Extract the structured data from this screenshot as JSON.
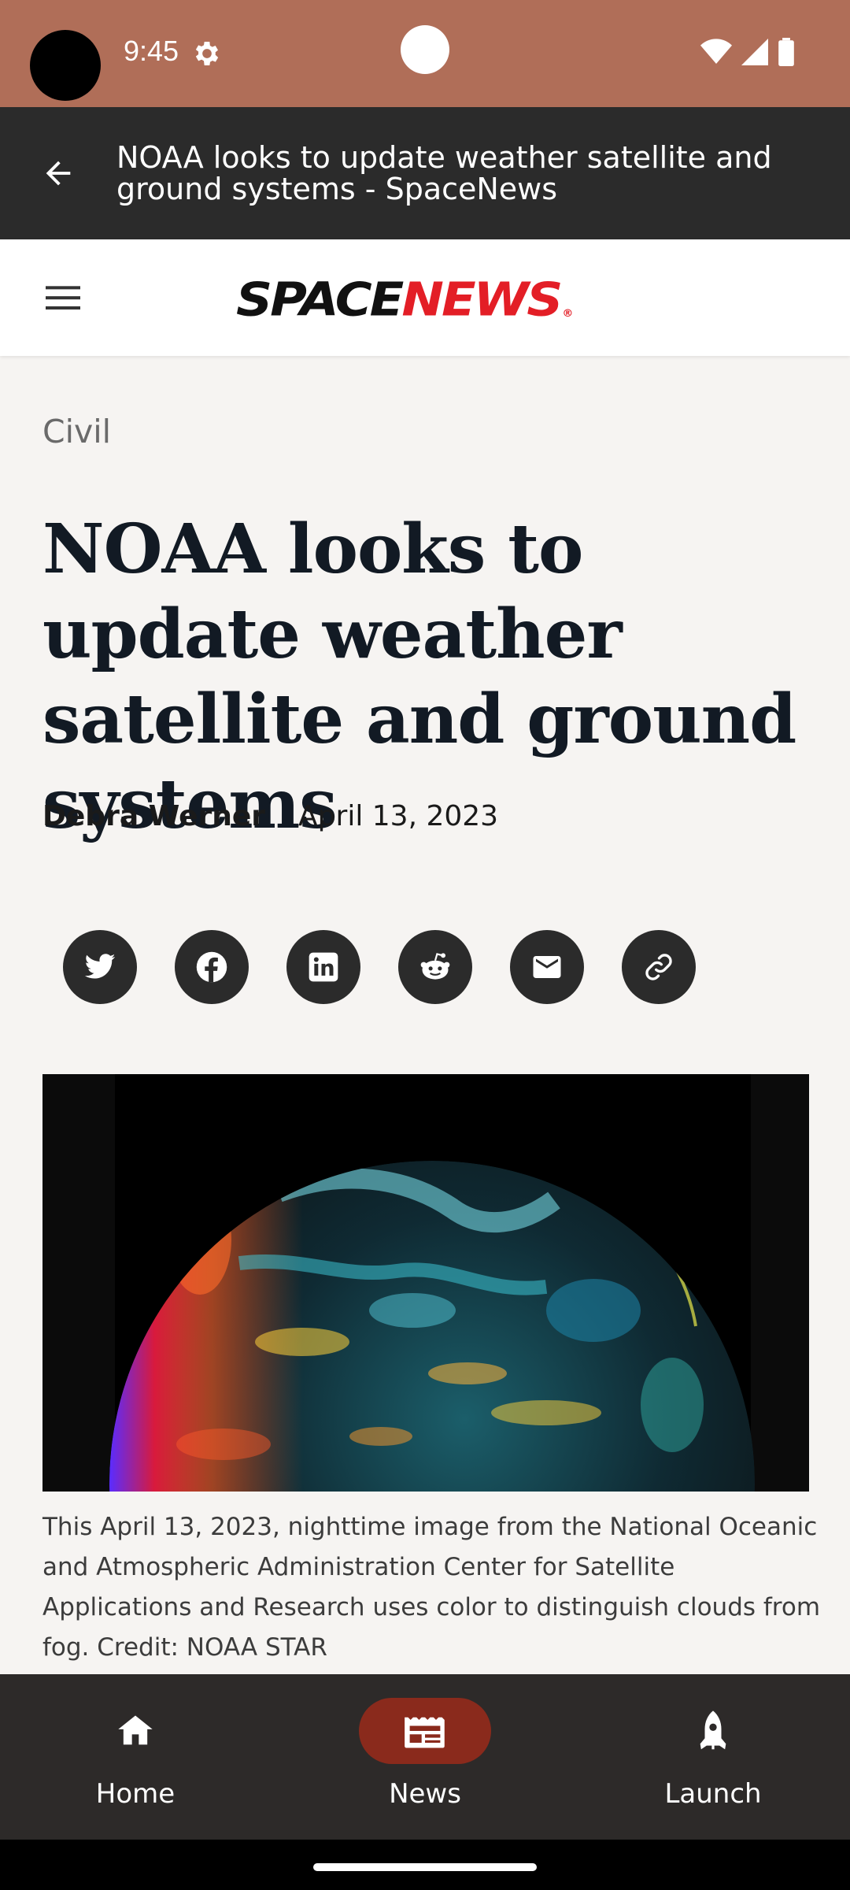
{
  "status_bar": {
    "time": "9:45",
    "color": "#b06e58"
  },
  "app_bar": {
    "title": "NOAA looks to update weather satellite and ground systems - SpaceNews",
    "back_icon": "arrow-left-icon"
  },
  "site_header": {
    "logo_space": "SPACE",
    "logo_news": "NEWS",
    "logo_mark": "®",
    "menu_icon": "hamburger-menu-icon",
    "brand_red": "#e31e26"
  },
  "article": {
    "category": "Civil",
    "headline": "NOAA looks to update weather satellite and ground systems",
    "author": "Debra Werner",
    "date": "April 13, 2023",
    "share_icons": [
      "twitter-icon",
      "facebook-icon",
      "linkedin-icon",
      "reddit-icon",
      "email-icon",
      "link-icon"
    ],
    "caption": "This April 13, 2023, nighttime image from the National Oceanic and Atmospheric Administration Center for Satellite Applications and Research uses color to distinguish clouds from fog. Credit: NOAA STAR"
  },
  "bottom_nav": {
    "items": [
      {
        "label": "Home",
        "icon": "home-icon",
        "active": false
      },
      {
        "label": "News",
        "icon": "news-icon",
        "active": true
      },
      {
        "label": "Launch",
        "icon": "rocket-icon",
        "active": false
      }
    ],
    "active_color": "#8a2a1c"
  }
}
